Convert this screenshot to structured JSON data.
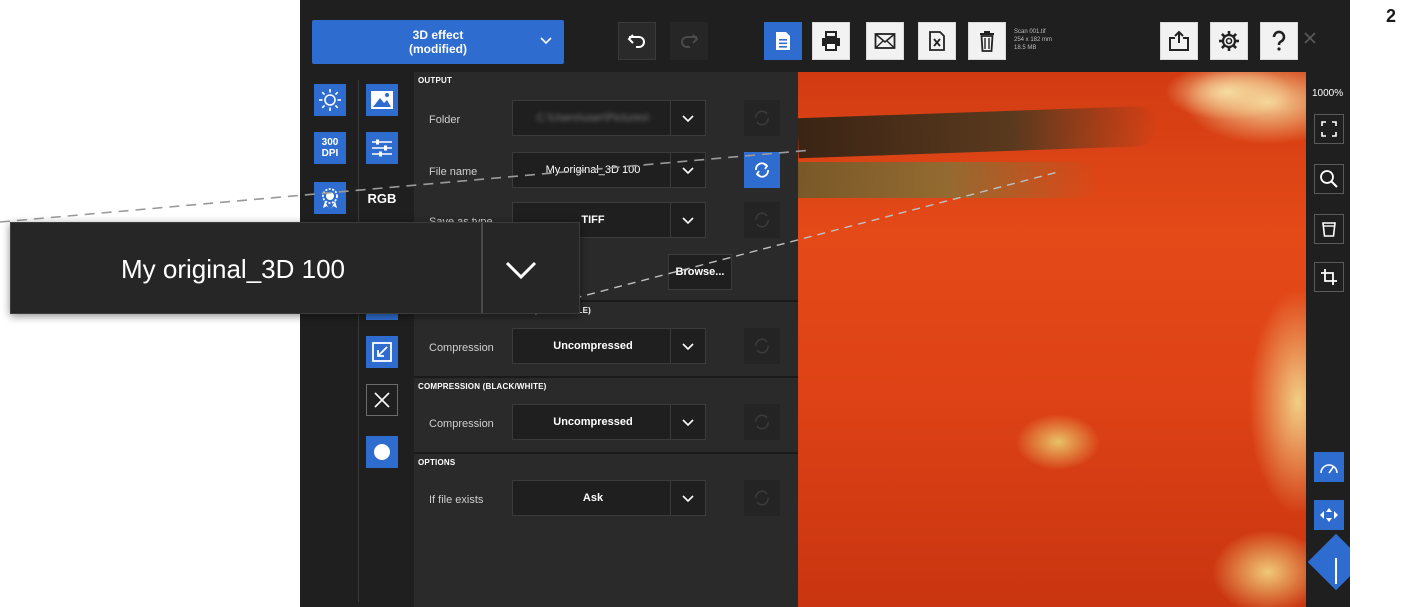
{
  "figure_number": "2",
  "toolbar": {
    "preset_label": "3D effect\n(modified)",
    "file_info": [
      "Scan 001.tif",
      "254 x 182 mm",
      "18.5 MB"
    ]
  },
  "left_tools": {
    "dpi_label": "300\nDPI",
    "rgb_label": "RGB"
  },
  "settings": {
    "output_title": "OUTPUT",
    "folder_label": "Folder",
    "folder_value": "C:\\Users\\user\\Pictures\\",
    "filename_label": "File name",
    "filename_value": "My original_3D 100",
    "filetype_label": "Save as type",
    "filetype_value": "TIFF",
    "browse_label": "Browse...",
    "compression_gray_title": "(GRAYSCALE)",
    "compression_label": "Compression",
    "compression_gray_value": "Uncompressed",
    "compression_bw_title": "COMPRESSION (BLACK/WHITE)",
    "compression_bw_value": "Uncompressed",
    "options_title": "OPTIONS",
    "if_exists_label": "If file exists",
    "if_exists_value": "Ask"
  },
  "right_tools": {
    "zoom_label": "1000%"
  },
  "callout": {
    "value": "My original_3D 100"
  },
  "colors": {
    "accent": "#2e6ccf",
    "panel": "#2a2a2a",
    "background": "#1f1f1f"
  }
}
